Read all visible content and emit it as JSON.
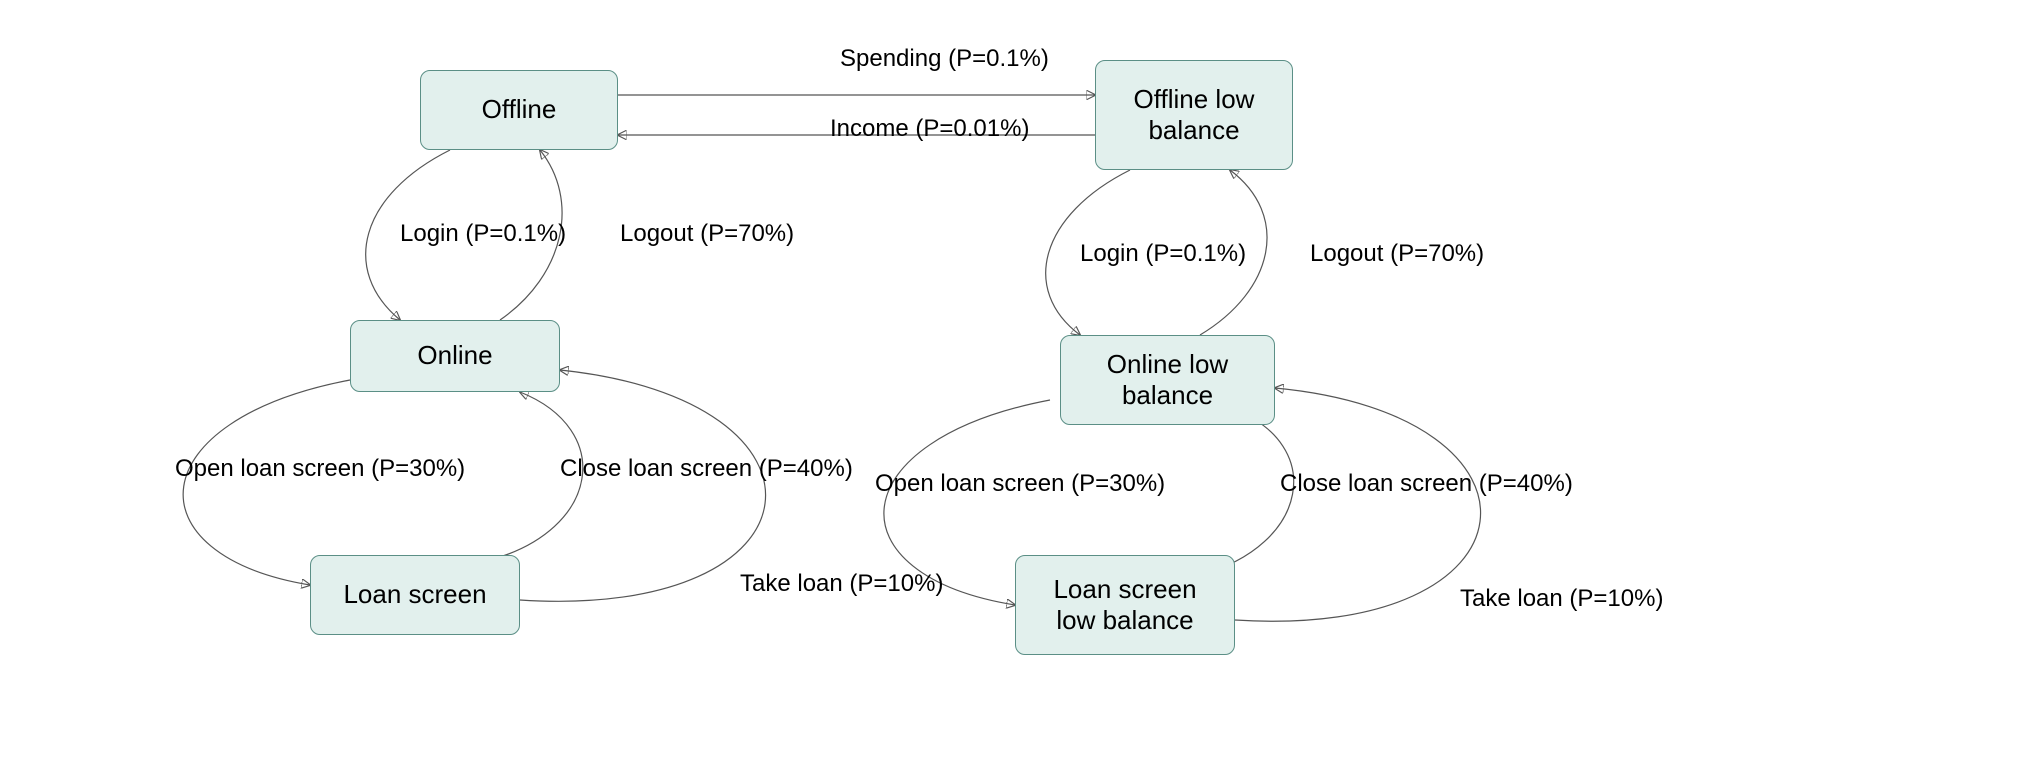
{
  "nodes": {
    "offline": {
      "label": "Offline"
    },
    "offline_low_balance": {
      "label": "Offline low\nbalance"
    },
    "online": {
      "label": "Online"
    },
    "online_low_balance": {
      "label": "Online low\nbalance"
    },
    "loan_screen": {
      "label": "Loan screen"
    },
    "loan_screen_low_balance": {
      "label": "Loan screen\nlow balance"
    }
  },
  "edges": {
    "spending": {
      "label": "Spending (P=0.1%)"
    },
    "income": {
      "label": "Income (P=0.01%)"
    },
    "login_left": {
      "label": "Login (P=0.1%)"
    },
    "logout_left": {
      "label": "Logout (P=70%)"
    },
    "login_right": {
      "label": "Login (P=0.1%)"
    },
    "logout_right": {
      "label": "Logout (P=70%)"
    },
    "open_loan_left": {
      "label": "Open loan screen (P=30%)"
    },
    "close_loan_left": {
      "label": "Close loan screen (P=40%)"
    },
    "take_loan_left": {
      "label": "Take loan (P=10%)"
    },
    "open_loan_right": {
      "label": "Open loan screen (P=30%)"
    },
    "close_loan_right": {
      "label": "Close loan screen (P=40%)"
    },
    "take_loan_right": {
      "label": "Take loan (P=10%)"
    }
  }
}
